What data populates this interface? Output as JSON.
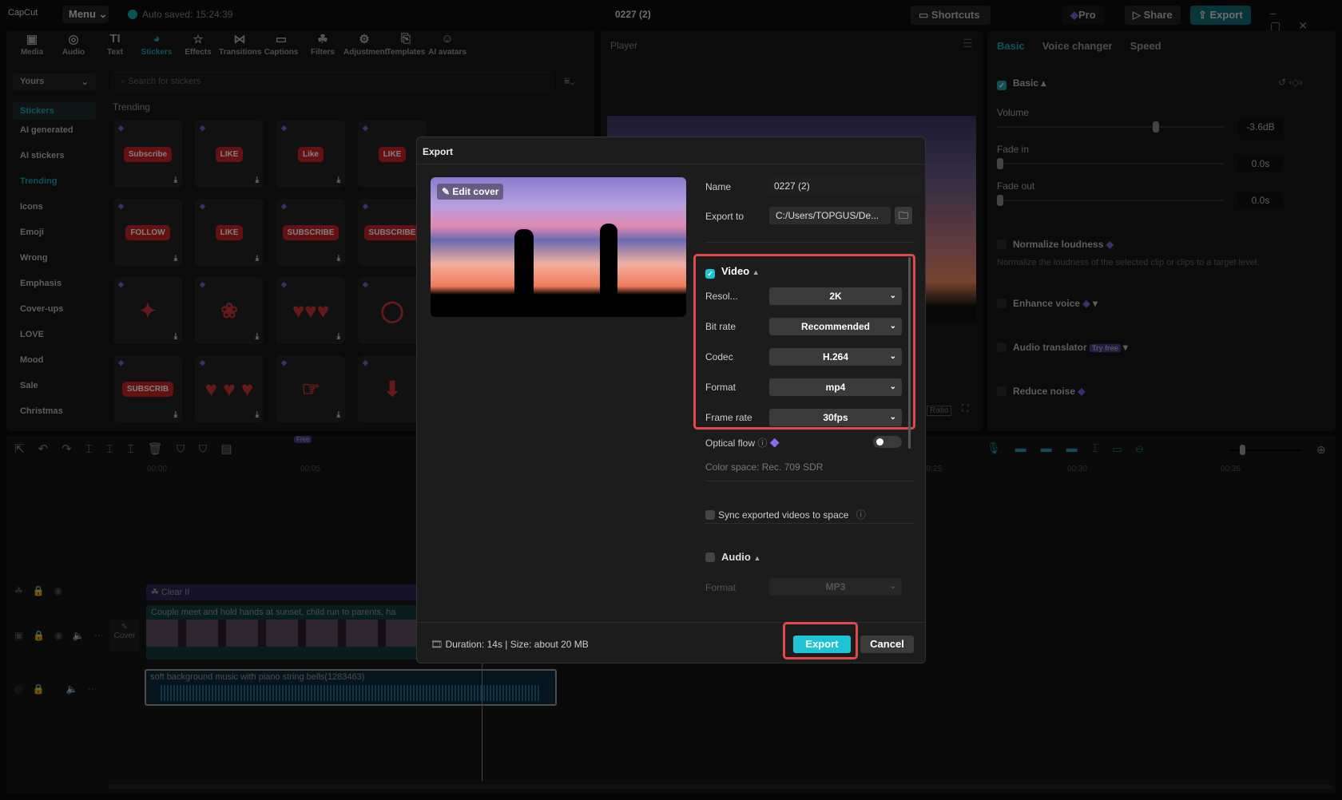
{
  "titlebar": {
    "logo": "CapCut",
    "menu": "Menu",
    "autosave": "Auto saved: 15:24:39",
    "project": "0227 (2)",
    "shortcuts": "Shortcuts",
    "pro": "Pro",
    "share": "Share",
    "export": "Export"
  },
  "tools": [
    {
      "icon": "▣",
      "label": "Media"
    },
    {
      "icon": "◎",
      "label": "Audio"
    },
    {
      "icon": "TI",
      "label": "Text"
    },
    {
      "icon": "◕",
      "label": "Stickers"
    },
    {
      "icon": "☆",
      "label": "Effects"
    },
    {
      "icon": "⋈",
      "label": "Transitions"
    },
    {
      "icon": "▭",
      "label": "Captions"
    },
    {
      "icon": "☘",
      "label": "Filters"
    },
    {
      "icon": "⚙",
      "label": "Adjustment"
    },
    {
      "icon": "⎘",
      "label": "Templates"
    },
    {
      "icon": "☺",
      "label": "AI avatars"
    }
  ],
  "stickers_panel": {
    "yours": "Yours",
    "search_placeholder": "Search for stickers",
    "section": "Trending",
    "categories": [
      "Stickers",
      "AI generated",
      "AI stickers",
      "Trending",
      "Icons",
      "Emoji",
      "Wrong",
      "Emphasis",
      "Cover-ups",
      "LOVE",
      "Mood",
      "Sale",
      "Christmas"
    ],
    "items": [
      "Subscribe",
      "LIKE",
      "Like",
      "LIKE",
      "",
      "FOLLOW",
      "LIKE",
      "SUBSCRIBE",
      "SUBSCRIBE",
      "",
      "✦",
      "❀",
      "♥♥♥",
      "◯",
      "",
      "SUBSCRIB",
      "♥ ♥ ♥",
      "☞",
      "⬇",
      ""
    ]
  },
  "player": {
    "title": "Player",
    "ratio": "Ratio"
  },
  "right_panel": {
    "tabs": [
      "Basic",
      "Voice changer",
      "Speed"
    ],
    "basic": "Basic",
    "volume": "Volume",
    "volume_value": "-3.6dB",
    "volume_level": 0.7,
    "fade_in": "Fade in",
    "fade_in_value": "0.0s",
    "fade_out": "Fade out",
    "fade_out_value": "0.0s",
    "normalize": "Normalize loudness",
    "normalize_desc": "Normalize the loudness of the selected clip or clips to a target level.",
    "enhance": "Enhance voice",
    "translator": "Audio translator",
    "try_free": "Try free",
    "reduce": "Reduce noise"
  },
  "timeline": {
    "free_badge": "Free",
    "ticks": [
      "00:00",
      "00:05",
      "00:25",
      "00:30",
      "00:35"
    ],
    "filter_clip": "Clear II",
    "video_clip": "Couple meet and hold hands at sunset, child run to parents, ha",
    "cover": "Cover",
    "audio_clip": "soft background music with piano string bells(1283463)"
  },
  "export_dialog": {
    "title": "Export",
    "edit_cover": "Edit cover",
    "name_label": "Name",
    "name_value": "0227 (2)",
    "export_to_label": "Export to",
    "export_to_value": "C:/Users/TOPGUS/De...",
    "video_section": "Video",
    "video_checked": true,
    "fields": [
      {
        "label": "Resol...",
        "value": "2K"
      },
      {
        "label": "Bit rate",
        "value": "Recommended"
      },
      {
        "label": "Codec",
        "value": "H.264"
      },
      {
        "label": "Format",
        "value": "mp4"
      },
      {
        "label": "Frame rate",
        "value": "30fps"
      }
    ],
    "optical_flow": "Optical flow",
    "optical_flow_on": false,
    "color_space": "Color space: Rec. 709 SDR",
    "sync": "Sync exported videos to space",
    "audio_section": "Audio",
    "audio_format_label": "Format",
    "audio_format_value": "MP3",
    "footer_info": "Duration: 14s | Size: about 20 MB",
    "export_button": "Export",
    "cancel_button": "Cancel",
    "accent": "#1ec4d4",
    "highlight": "#e0484a"
  }
}
